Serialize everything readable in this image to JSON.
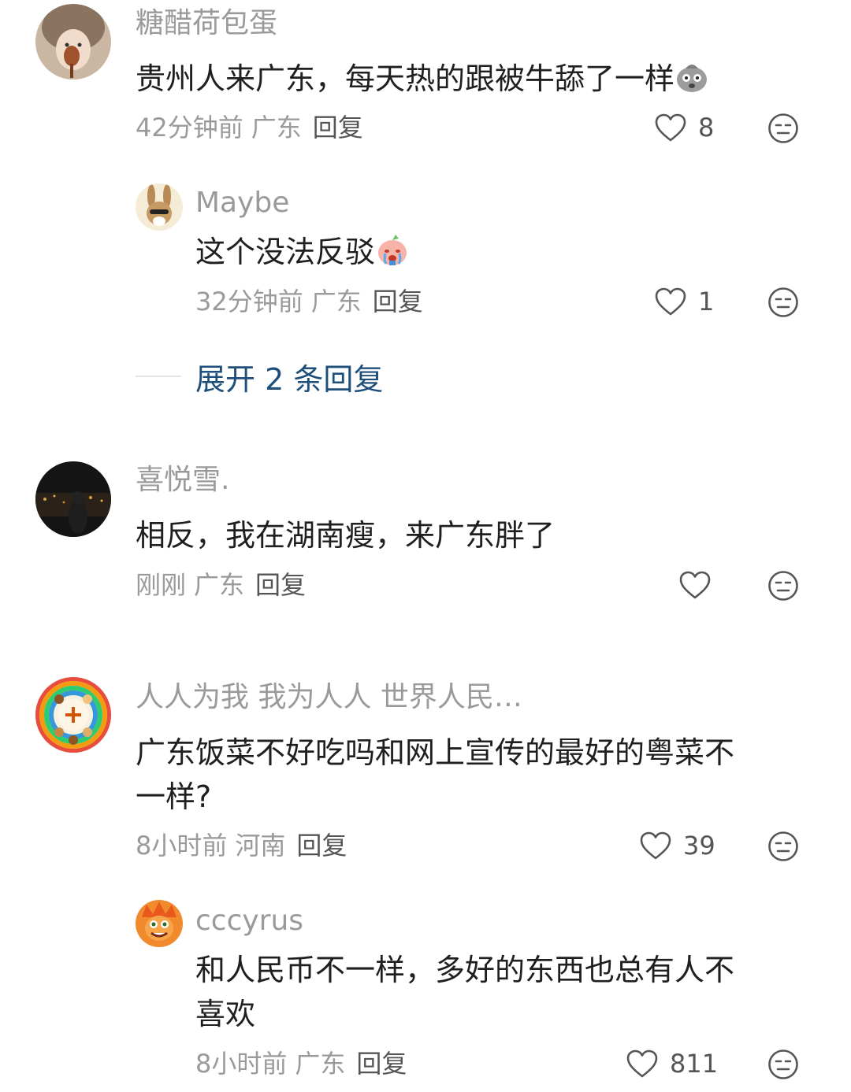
{
  "comments": [
    {
      "username": "糖醋荷包蛋",
      "text": "贵州人来广东，每天热的跟被牛舔了一样",
      "emoji": "sweat-face-emoji",
      "time": "42分钟前",
      "region": "广东",
      "reply": "回复",
      "likes": "8"
    },
    {
      "username": "Maybe",
      "text": "这个没法反驳",
      "emoji": "crying-peach-emoji",
      "time": "32分钟前",
      "region": "广东",
      "reply": "回复",
      "likes": "1"
    },
    {
      "username": "喜悦雪.",
      "text": "相反，我在湖南瘦，来广东胖了",
      "time": "刚刚",
      "region": "广东",
      "reply": "回复",
      "likes": ""
    },
    {
      "username": "人人为我 我为人人 世界人民…",
      "text_line1": "广东饭菜不好吃吗和网上宣传的最好的粤菜不",
      "text_line2": "一样?",
      "time": "8小时前",
      "region": "河南",
      "reply": "回复",
      "likes": "39"
    },
    {
      "username": "cccyrus",
      "text_line1": "和人民币不一样，多好的东西也总有人不",
      "text_line2": "喜欢",
      "time": "8小时前",
      "region": "广东",
      "reply": "回复",
      "likes": "811"
    }
  ],
  "expand_replies": "展开 2 条回复",
  "icons": {
    "like": "heart-outline-icon",
    "more": "neutral-face-icon"
  }
}
